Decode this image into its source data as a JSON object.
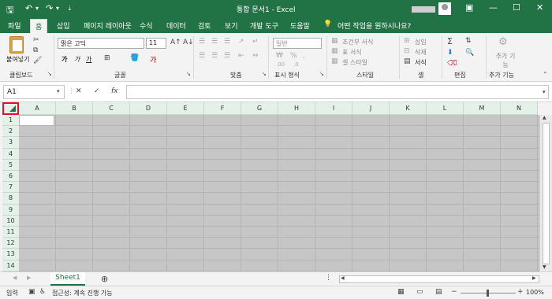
{
  "titlebar": {
    "title": "통합 문서1 - Excel",
    "icons": [
      "save-icon",
      "undo-icon",
      "redo-icon",
      "customize-icon"
    ],
    "window_controls": [
      "ribbon-options-icon",
      "minimize-icon",
      "maximize-icon",
      "close-icon"
    ]
  },
  "tabs": [
    "파일",
    "홈",
    "삽입",
    "페이지 레이아웃",
    "수식",
    "데이터",
    "검토",
    "보기",
    "개발 도구",
    "도움말"
  ],
  "active_tab": "홈",
  "tell_me": "어떤 작업을 원하시나요?",
  "ribbon": {
    "clipboard": {
      "paste": "붙여넣기",
      "label": "클립보드"
    },
    "font": {
      "name": "맑은 고딕",
      "size": "11",
      "label": "글꼴",
      "bold": "가",
      "italic": "가",
      "underline": "가"
    },
    "alignment": {
      "label": "맞춤"
    },
    "number": {
      "format": "일반",
      "label": "표시 형식"
    },
    "styles": {
      "conditional": "조건부 서식",
      "table": "표 서식",
      "cell": "셀 스타일",
      "label": "스타일"
    },
    "cells": {
      "insert": "삽입",
      "delete": "삭제",
      "format": "서식",
      "label": "셀"
    },
    "editing": {
      "label": "편집"
    },
    "addins": {
      "button": "추가 기능",
      "label": "추가 기능"
    }
  },
  "formula_bar": {
    "name_box": "A1",
    "cancel": "✕",
    "enter": "✓",
    "fx": "fx",
    "value": ""
  },
  "columns": [
    "A",
    "B",
    "C",
    "D",
    "E",
    "F",
    "G",
    "H",
    "I",
    "J",
    "K",
    "L",
    "M",
    "N"
  ],
  "rows": [
    "1",
    "2",
    "3",
    "4",
    "5",
    "6",
    "7",
    "8",
    "9",
    "10",
    "11",
    "12",
    "13",
    "14"
  ],
  "sheets": [
    "Sheet1"
  ],
  "add_sheet": "⊕",
  "status": {
    "mode": "입력",
    "accessibility": "접근성: 계속 진행 가능",
    "zoom": "100%",
    "zoom_minus": "−",
    "zoom_plus": "+"
  }
}
